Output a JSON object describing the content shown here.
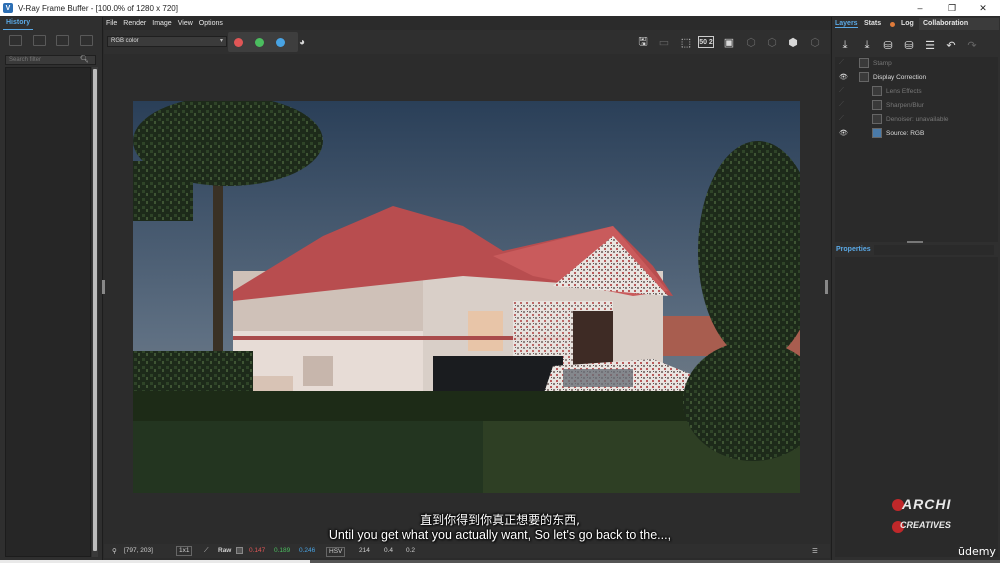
{
  "window": {
    "title": "V-Ray Frame Buffer - [100.0% of 1280 x 720]",
    "app_icon": "V",
    "controls": [
      "–",
      "❐",
      "✕"
    ]
  },
  "history_panel": {
    "tab": "History",
    "search_placeholder": "Search filter"
  },
  "menu": [
    "File",
    "Render",
    "Image",
    "View",
    "Options"
  ],
  "toolbar": {
    "channel_select": "RGB color",
    "channel_dots": [
      "#e05656",
      "#4bbd5f",
      "#48a3e3"
    ],
    "zoom_label": "50 2"
  },
  "status": {
    "coords": "[797, 203]",
    "zoom": "1x1",
    "raw_label": "Raw",
    "r": "0.147",
    "g": "0.189",
    "b": "0.246",
    "mode": "HSV",
    "h": "214",
    "s": "0.4",
    "v": "0.2"
  },
  "right_panel": {
    "tabs": [
      "Layers",
      "Stats",
      "Log",
      "Collaboration"
    ],
    "layers": [
      {
        "label": "Stamp",
        "visible": false,
        "indent": 0
      },
      {
        "label": "Display Correction",
        "visible": true,
        "indent": 0
      },
      {
        "label": "Lens Effects",
        "visible": false,
        "indent": 1
      },
      {
        "label": "Sharpen/Blur",
        "visible": false,
        "indent": 1
      },
      {
        "label": "Denoiser: unavailable",
        "visible": false,
        "indent": 1
      },
      {
        "label": "Source: RGB",
        "visible": true,
        "indent": 1
      }
    ],
    "properties_title": "Properties"
  },
  "overlay": {
    "subtitle_cn": "直到你得到你真正想要的东西,",
    "subtitle_en": "Until you get what you actually want, So let's go back to the...,",
    "brand_top": "ARCHI",
    "brand_bottom": "CREATIVES",
    "platform": "ūdemy"
  },
  "video_progress": 0.31
}
